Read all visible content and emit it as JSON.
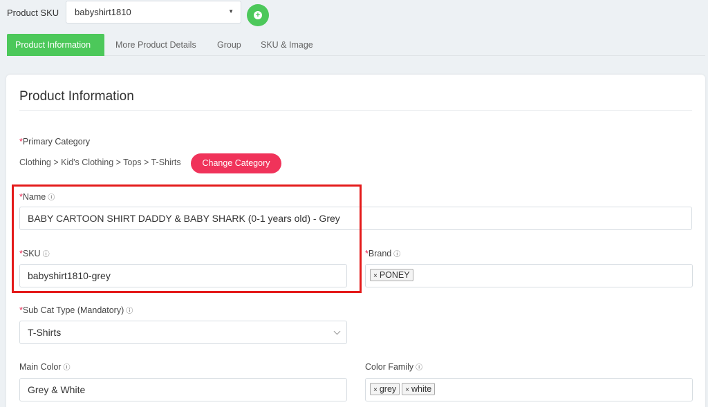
{
  "header": {
    "sku_label": "Product SKU",
    "sku_value": "babyshirt1810",
    "add_icon": "plus-circle-icon"
  },
  "tabs": [
    {
      "label": "Product Information",
      "active": true
    },
    {
      "label": "More Product Details",
      "active": false
    },
    {
      "label": "Group",
      "active": false
    },
    {
      "label": "SKU & Image",
      "active": false
    }
  ],
  "section": {
    "title": "Product Information"
  },
  "category": {
    "label": "Primary Category",
    "path": "Clothing > Kid's Clothing > Tops > T-Shirts",
    "change_label": "Change Category"
  },
  "fields": {
    "name": {
      "label": "Name",
      "value": "BABY CARTOON SHIRT DADDY & BABY SHARK (0-1 years old) - Grey"
    },
    "sku": {
      "label": "SKU",
      "value": "babyshirt1810-grey"
    },
    "brand": {
      "label": "Brand",
      "tags": [
        "PONEY"
      ]
    },
    "subcat": {
      "label": "Sub Cat Type (Mandatory)",
      "value": "T-Shirts"
    },
    "main_color": {
      "label": "Main Color",
      "value": "Grey & White"
    },
    "color_family": {
      "label": "Color Family",
      "tags": [
        "grey",
        "white"
      ]
    }
  },
  "colors": {
    "accent_green": "#4cc85a",
    "required_red": "#e5244f",
    "change_button": "#f0335a",
    "highlight_box": "#e41a1a"
  },
  "symbols": {
    "required": "*",
    "info": "ⓘ",
    "remove": "×"
  }
}
